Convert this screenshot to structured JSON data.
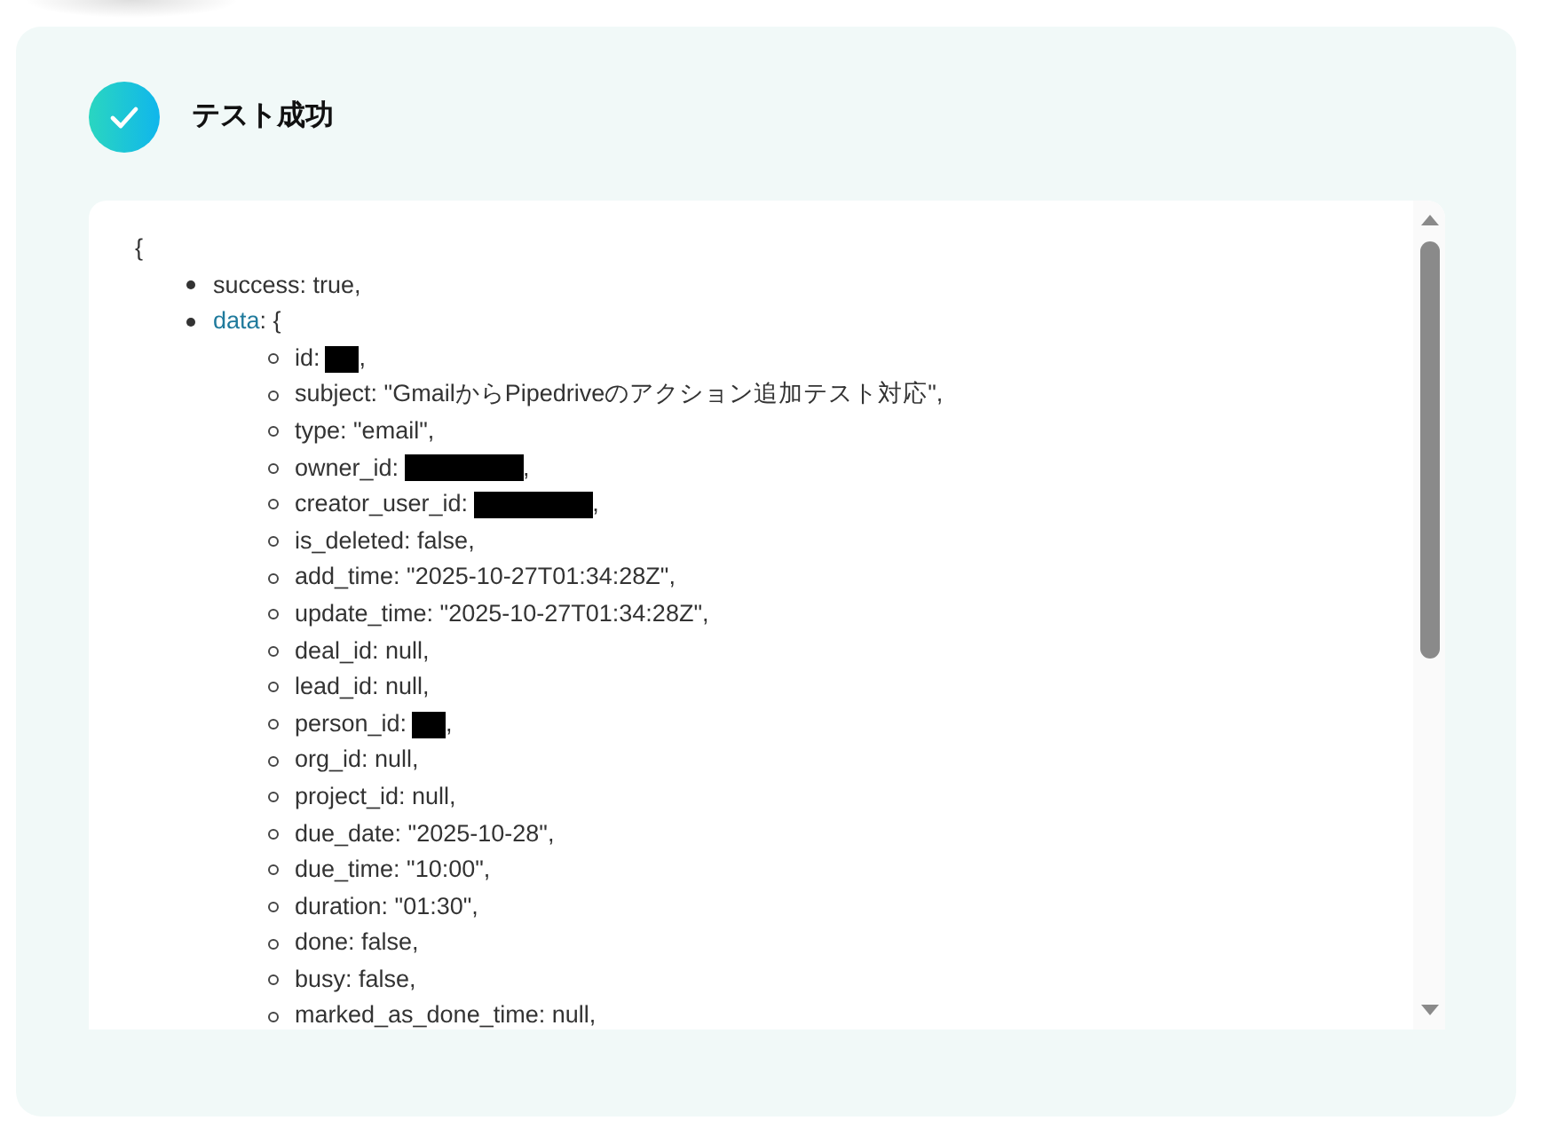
{
  "header": {
    "success": true,
    "title": "テスト成功"
  },
  "output": {
    "open": "{",
    "items": [
      {
        "text": "success: true,"
      },
      {
        "key": "data",
        "text": ": {",
        "children": [
          {
            "kind": "redacted",
            "text": "id:",
            "after": ","
          },
          {
            "kind": "plain",
            "text": "subject: \"GmailからPipedriveのアクション追加テスト対応\","
          },
          {
            "kind": "plain",
            "text": "type: \"email\","
          },
          {
            "kind": "redactedwide",
            "text": "owner_id:",
            "after": ","
          },
          {
            "kind": "redactedwide",
            "text": "creator_user_id:",
            "after": ","
          },
          {
            "kind": "plain",
            "text": "is_deleted: false,"
          },
          {
            "kind": "plain",
            "text": "add_time: \"2025-10-27T01:34:28Z\","
          },
          {
            "kind": "plain",
            "text": "update_time: \"2025-10-27T01:34:28Z\","
          },
          {
            "kind": "plain",
            "text": "deal_id: null,"
          },
          {
            "kind": "plain",
            "text": "lead_id: null,"
          },
          {
            "kind": "redacted",
            "text": "person_id:",
            "after": ","
          },
          {
            "kind": "plain",
            "text": "org_id: null,"
          },
          {
            "kind": "plain",
            "text": "project_id: null,"
          },
          {
            "kind": "plain",
            "text": "due_date: \"2025-10-28\","
          },
          {
            "kind": "plain",
            "text": "due_time: \"10:00\","
          },
          {
            "kind": "plain",
            "text": "duration: \"01:30\","
          },
          {
            "kind": "plain",
            "text": "done: false,"
          },
          {
            "kind": "plain",
            "text": "busy: false,"
          },
          {
            "kind": "plain",
            "text": "marked_as_done_time: null,"
          }
        ]
      }
    ]
  }
}
